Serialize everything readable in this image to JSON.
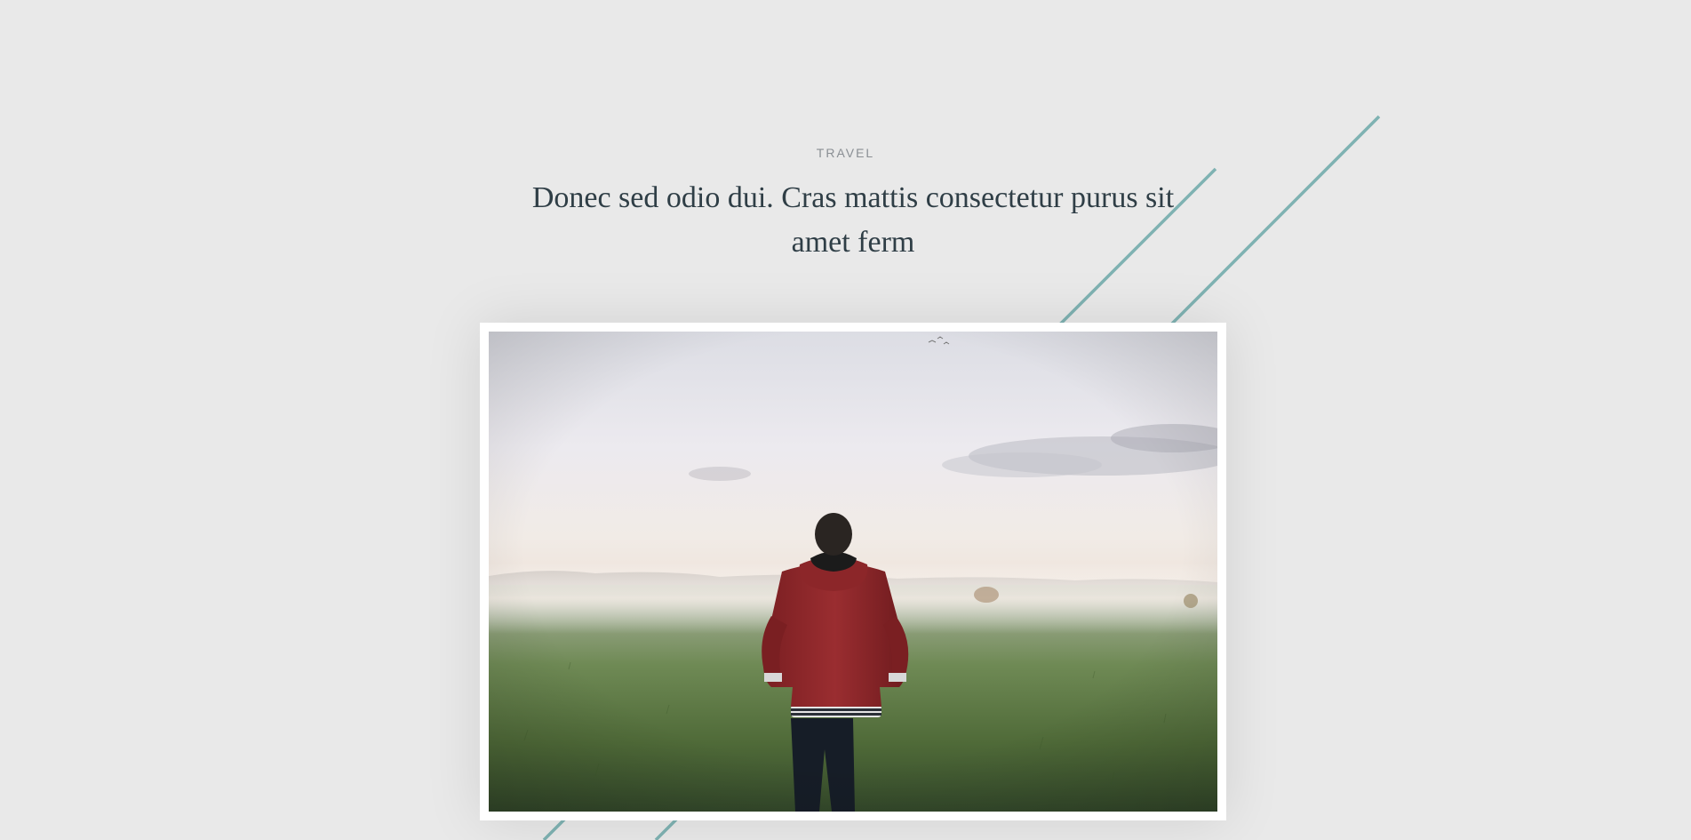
{
  "post": {
    "category": "TRAVEL",
    "title": "Donec sed odio dui. Cras mattis consectetur purus sit amet ferm"
  },
  "image": {
    "subject": "person in red hooded jacket standing in misty green field, seen from behind"
  },
  "colors": {
    "background": "#e9e9e9",
    "accent_lines": "#7fb2b2",
    "title_text": "#2f3e46",
    "category_text": "#8a8f94",
    "frame": "#ffffff"
  }
}
